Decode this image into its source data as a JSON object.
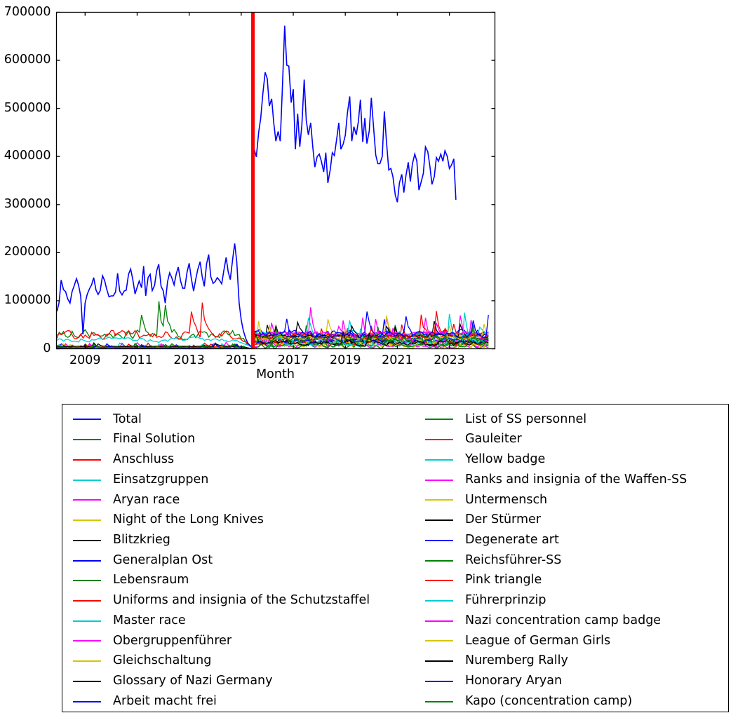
{
  "chart_data": {
    "type": "line",
    "title": "",
    "xlabel": "Month",
    "ylabel": "",
    "xlim": [
      2007.9,
      2024.75
    ],
    "ylim": [
      0,
      700000
    ],
    "grid": false,
    "legend_position": "below-axes",
    "yticks": [
      0,
      100000,
      200000,
      300000,
      400000,
      500000,
      600000,
      700000
    ],
    "ytick_labels": [
      "0",
      "100000",
      "200000",
      "300000",
      "400000",
      "500000",
      "600000",
      "700000"
    ],
    "xticks": [
      2009,
      2011,
      2013,
      2015,
      2017,
      2019,
      2021,
      2023
    ],
    "xtick_labels": [
      "2009",
      "2011",
      "2013",
      "2015",
      "2017",
      "2019",
      "2021",
      "2023"
    ],
    "annotations": [
      {
        "name": "data-discontinuity-marker",
        "kind": "vertical-line",
        "x": 2015.45,
        "color": "#ff0000",
        "linewidth": 5
      }
    ],
    "series": [
      {
        "name": "Total",
        "color": "#0000ff",
        "segments": [
          {
            "x": [
              2007.92,
              2008.0,
              2008.08,
              2008.17,
              2008.25,
              2008.33,
              2008.42,
              2008.5,
              2008.58,
              2008.67,
              2008.75,
              2008.83,
              2008.92,
              2009.0,
              2009.08,
              2009.17,
              2009.25,
              2009.33,
              2009.42,
              2009.5,
              2009.58,
              2009.67,
              2009.75,
              2009.83,
              2009.92,
              2010.0,
              2010.08,
              2010.17,
              2010.25,
              2010.33,
              2010.42,
              2010.5,
              2010.58,
              2010.67,
              2010.75,
              2010.83,
              2010.92,
              2011.0,
              2011.08,
              2011.17,
              2011.25,
              2011.33,
              2011.42,
              2011.5,
              2011.58,
              2011.67,
              2011.75,
              2011.83,
              2011.92,
              2012.0,
              2012.08,
              2012.17,
              2012.25,
              2012.33,
              2012.42,
              2012.5,
              2012.58,
              2012.67,
              2012.75,
              2012.83,
              2012.92,
              2013.0,
              2013.08,
              2013.17,
              2013.25,
              2013.33,
              2013.42,
              2013.5,
              2013.58,
              2013.67,
              2013.75,
              2013.83,
              2013.92,
              2014.0,
              2014.08,
              2014.17,
              2014.25,
              2014.33,
              2014.42,
              2014.5,
              2014.58,
              2014.67,
              2014.75,
              2014.83,
              2014.92,
              2015.0,
              2015.08,
              2015.17,
              2015.25,
              2015.33,
              2015.42
            ],
            "y": [
              78000,
              96000,
              143000,
              123000,
              119000,
              104000,
              95000,
              119000,
              131000,
              146000,
              132000,
              110000,
              30000,
              95000,
              113000,
              125000,
              133000,
              148000,
              122000,
              113000,
              121000,
              152000,
              142000,
              124000,
              108000,
              110000,
              110000,
              118000,
              157000,
              120000,
              112000,
              120000,
              122000,
              155000,
              166000,
              145000,
              114000,
              128000,
              141000,
              127000,
              172000,
              110000,
              148000,
              155000,
              121000,
              132000,
              162000,
              176000,
              130000,
              121000,
              95000,
              140000,
              158000,
              148000,
              133000,
              155000,
              170000,
              141000,
              126000,
              126000,
              160000,
              178000,
              147000,
              120000,
              144000,
              165000,
              181000,
              150000,
              130000,
              177000,
              196000,
              150000,
              136000,
              140000,
              148000,
              142000,
              135000,
              162000,
              190000,
              160000,
              144000,
              186000,
              219000,
              180000,
              95000,
              60000,
              38000,
              22000,
              12000,
              7000,
              3000
            ]
          },
          {
            "x": [
              2015.5,
              2015.58,
              2015.67,
              2015.75,
              2015.83,
              2015.92,
              2016.0,
              2016.08,
              2016.17,
              2016.25,
              2016.33,
              2016.42,
              2016.5,
              2016.58,
              2016.67,
              2016.75,
              2016.83,
              2016.92,
              2017.0,
              2017.08,
              2017.17,
              2017.25,
              2017.33,
              2017.42,
              2017.5,
              2017.58,
              2017.67,
              2017.75,
              2017.83,
              2017.92,
              2018.0,
              2018.08,
              2018.17,
              2018.25,
              2018.33,
              2018.42,
              2018.5,
              2018.58,
              2018.67,
              2018.75,
              2018.83,
              2018.92,
              2019.0,
              2019.08,
              2019.17,
              2019.25,
              2019.33,
              2019.42,
              2019.5,
              2019.58,
              2019.67,
              2019.75,
              2019.83,
              2019.92,
              2020.0,
              2020.08,
              2020.17,
              2020.25,
              2020.33,
              2020.42,
              2020.5,
              2020.58,
              2020.67,
              2020.75,
              2020.83,
              2020.92,
              2021.0,
              2021.08,
              2021.17,
              2021.25,
              2021.33,
              2021.42,
              2021.5,
              2021.58,
              2021.67,
              2021.75,
              2021.83,
              2021.92,
              2022.0,
              2022.08,
              2022.17,
              2022.25,
              2022.33,
              2022.42,
              2022.5,
              2022.58,
              2022.67,
              2022.75,
              2022.83,
              2022.92,
              2023.0,
              2023.08,
              2023.17,
              2023.25,
              2023.33,
              2023.42,
              2023.5,
              2023.58,
              2023.67,
              2023.75,
              2023.83,
              2023.92,
              2024.0,
              2024.08,
              2024.17,
              2024.25,
              2024.33,
              2024.42,
              2024.5,
              2024.58
            ],
            "y": [
              415000,
              399000,
              450000,
              480000,
              530000,
              575000,
              562000,
              505000,
              520000,
              470000,
              432000,
              452000,
              432000,
              540000,
              672000,
              590000,
              588000,
              512000,
              540000,
              415000,
              489000,
              420000,
              465000,
              560000,
              475000,
              445000,
              470000,
              420000,
              378000,
              400000,
              405000,
              390000,
              368000,
              408000,
              345000,
              372000,
              408000,
              402000,
              437000,
              470000,
              415000,
              426000,
              444000,
              490000,
              525000,
              432000,
              462000,
              445000,
              472000,
              518000,
              430000,
              480000,
              427000,
              453000,
              522000,
              465000,
              403000,
              385000,
              385000,
              400000,
              494000,
              432000,
              372000,
              375000,
              358000,
              320000,
              305000,
              345000,
              363000,
              325000,
              360000,
              388000,
              348000,
              385000,
              405000,
              390000,
              330000,
              348000,
              365000,
              420000,
              410000,
              380000,
              342000,
              358000,
              398000,
              390000,
              405000,
              390000,
              412000,
              400000,
              375000,
              382000,
              395000,
              310000
            ]
          }
        ]
      },
      {
        "name": "Final Solution",
        "color": "#008000",
        "band": "high"
      },
      {
        "name": "Anschluss",
        "color": "#ff0000",
        "band": "high"
      },
      {
        "name": "Einsatzgruppen",
        "color": "#00ced1",
        "band": "mid"
      },
      {
        "name": "Aryan race",
        "color": "#ff00ff",
        "band": "low"
      },
      {
        "name": "Night of the Long Knives",
        "color": "#d4c800",
        "band": "low"
      },
      {
        "name": "Blitzkrieg",
        "color": "#000000",
        "band": "low"
      },
      {
        "name": "Generalplan Ost",
        "color": "#0000ff",
        "band": "low"
      },
      {
        "name": "Lebensraum",
        "color": "#008000",
        "band": "low"
      },
      {
        "name": "Uniforms and insignia of the Schutzstaffel",
        "color": "#ff0000",
        "band": "low"
      },
      {
        "name": "Master race",
        "color": "#00ced1",
        "band": "low"
      },
      {
        "name": "Obergruppenführer",
        "color": "#ff00ff",
        "band": "low"
      },
      {
        "name": "Gleichschaltung",
        "color": "#d4c800",
        "band": "low"
      },
      {
        "name": "Glossary of Nazi Germany",
        "color": "#000000",
        "band": "low"
      },
      {
        "name": "Arbeit macht frei",
        "color": "#0000ff",
        "band": "low"
      },
      {
        "name": "List of SS personnel",
        "color": "#008000",
        "band": "low"
      },
      {
        "name": "Gauleiter",
        "color": "#ff0000",
        "band": "low"
      },
      {
        "name": "Yellow badge",
        "color": "#00ced1",
        "band": "low"
      },
      {
        "name": "Ranks and insignia of the Waffen-SS",
        "color": "#ff00ff",
        "band": "low"
      },
      {
        "name": "Untermensch",
        "color": "#d4c800",
        "band": "low"
      },
      {
        "name": "Der Stürmer",
        "color": "#000000",
        "band": "low"
      },
      {
        "name": "Degenerate art",
        "color": "#0000ff",
        "band": "low"
      },
      {
        "name": "Reichsführer-SS",
        "color": "#008000",
        "band": "low"
      },
      {
        "name": "Pink triangle",
        "color": "#ff0000",
        "band": "low"
      },
      {
        "name": "Führerprinzip",
        "color": "#00ced1",
        "band": "low"
      },
      {
        "name": "Nazi concentration camp badge",
        "color": "#ff00ff",
        "band": "low"
      },
      {
        "name": "League of German Girls",
        "color": "#d4c800",
        "band": "low"
      },
      {
        "name": "Nuremberg Rally",
        "color": "#000000",
        "band": "low"
      },
      {
        "name": "Honorary Aryan",
        "color": "#0000ff",
        "band": "low"
      },
      {
        "name": "Kapo (concentration camp)",
        "color": "#008000",
        "band": "low"
      }
    ]
  },
  "axes": {
    "xlabel": "Month",
    "ytick_labels": [
      "700000",
      "600000",
      "500000",
      "400000",
      "300000",
      "200000",
      "100000",
      "0"
    ],
    "xtick_labels": [
      "2009",
      "2011",
      "2013",
      "2015",
      "2017",
      "2019",
      "2021",
      "2023"
    ]
  },
  "legend": {
    "columns": [
      {
        "entries": [
          {
            "label": "Total",
            "color": "#0000ff"
          },
          {
            "label": "Final Solution",
            "color": "#008000"
          },
          {
            "label": "Anschluss",
            "color": "#ff0000"
          },
          {
            "label": "Einsatzgruppen",
            "color": "#00ced1"
          },
          {
            "label": "Aryan race",
            "color": "#ff00ff"
          },
          {
            "label": "Night of the Long Knives",
            "color": "#d4c800"
          },
          {
            "label": "Blitzkrieg",
            "color": "#000000"
          },
          {
            "label": "Generalplan Ost",
            "color": "#0000ff"
          },
          {
            "label": "Lebensraum",
            "color": "#008000"
          },
          {
            "label": "Uniforms and insignia of the Schutzstaffel",
            "color": "#ff0000"
          },
          {
            "label": "Master race",
            "color": "#00ced1"
          },
          {
            "label": "Obergruppenführer",
            "color": "#ff00ff"
          },
          {
            "label": "Gleichschaltung",
            "color": "#d4c800"
          },
          {
            "label": "Glossary of Nazi Germany",
            "color": "#000000"
          },
          {
            "label": "Arbeit macht frei",
            "color": "#0000ff"
          }
        ]
      },
      {
        "entries": [
          {
            "label": "List of SS personnel",
            "color": "#008000"
          },
          {
            "label": "Gauleiter",
            "color": "#ff0000"
          },
          {
            "label": "Yellow badge",
            "color": "#00ced1"
          },
          {
            "label": "Ranks and insignia of the Waffen-SS",
            "color": "#ff00ff"
          },
          {
            "label": "Untermensch",
            "color": "#d4c800"
          },
          {
            "label": "Der Stürmer",
            "color": "#000000"
          },
          {
            "label": "Degenerate art",
            "color": "#0000ff"
          },
          {
            "label": "Reichsführer-SS",
            "color": "#008000"
          },
          {
            "label": "Pink triangle",
            "color": "#ff0000"
          },
          {
            "label": "Führerprinzip",
            "color": "#00ced1"
          },
          {
            "label": "Nazi concentration camp badge",
            "color": "#ff00ff"
          },
          {
            "label": "League of German Girls",
            "color": "#d4c800"
          },
          {
            "label": "Nuremberg Rally",
            "color": "#000000"
          },
          {
            "label": "Honorary Aryan",
            "color": "#0000ff"
          },
          {
            "label": "Kapo (concentration camp)",
            "color": "#008000"
          }
        ]
      }
    ]
  }
}
